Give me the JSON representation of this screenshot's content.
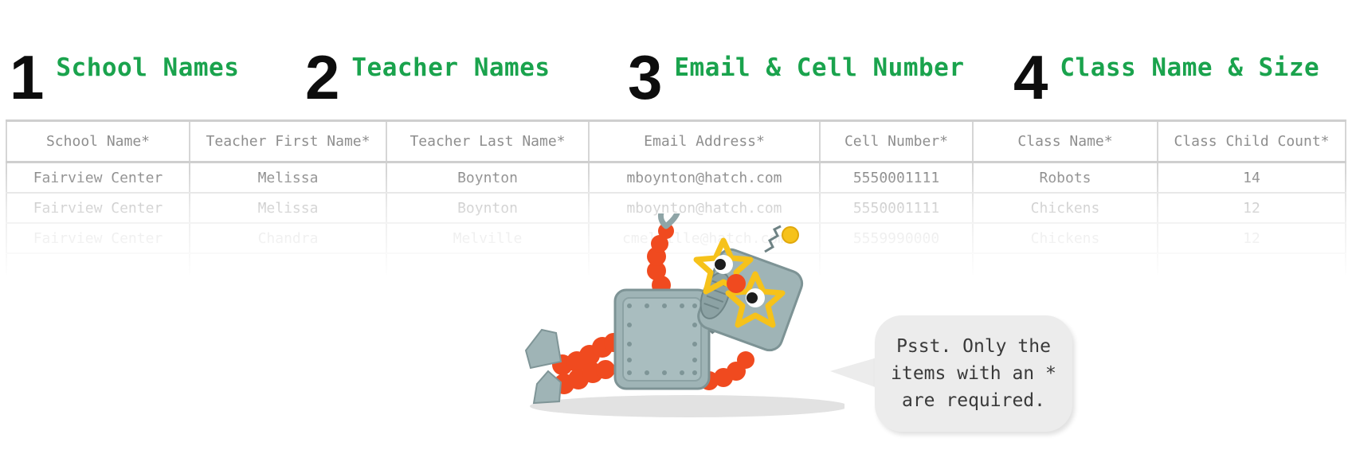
{
  "steps": [
    {
      "number": "1",
      "label": "School Names"
    },
    {
      "number": "2",
      "label": "Teacher Names"
    },
    {
      "number": "3",
      "label": "Email & Cell Number"
    },
    {
      "number": "4",
      "label": "Class Name & Size"
    }
  ],
  "table": {
    "headers": [
      "School Name*",
      "Teacher First Name*",
      "Teacher Last Name*",
      "Email Address*",
      "Cell Number*",
      "Class Name*",
      "Class Child Count*"
    ],
    "rows": [
      [
        "Fairview Center",
        "Melissa",
        "Boynton",
        "mboynton@hatch.com",
        "5550001111",
        "Robots",
        "14"
      ],
      [
        "Fairview Center",
        "Melissa",
        "Boynton",
        "mboynton@hatch.com",
        "5550001111",
        "Chickens",
        "12"
      ],
      [
        "Fairview Center",
        "Chandra",
        "Melville",
        "cmelville@hatch.com",
        "5559990000",
        "Chickens",
        "12"
      ]
    ]
  },
  "bubble": {
    "lines": [
      "Psst. Only the",
      "items with an *",
      "are required."
    ]
  },
  "colors": {
    "step_label": "#1aa34d",
    "step_number": "#0d0d0d",
    "robot_body": "#9fb4b6",
    "robot_limbs": "#f04a1f",
    "glasses": "#f6c21a"
  },
  "illustration": {
    "name": "robot-with-star-glasses"
  }
}
